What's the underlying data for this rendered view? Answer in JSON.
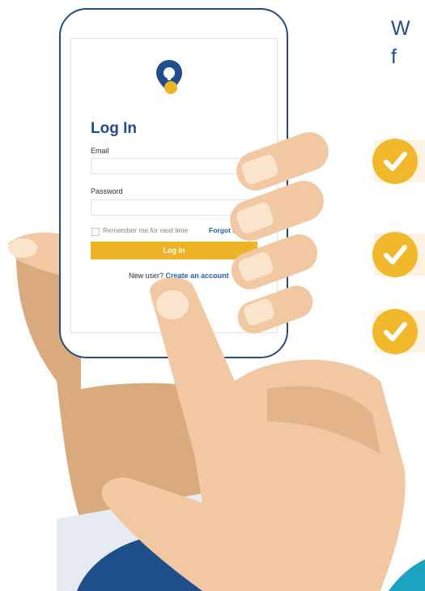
{
  "side_heading": "W\nf",
  "login_screen": {
    "title": "Log In",
    "email_label": "Email",
    "password_label": "Password",
    "remember_label": "Remember me for next time",
    "forgot_label": "Forgot Par",
    "login_button": "Log In",
    "new_user_text": "New user?",
    "create_account_link": "Create an account"
  },
  "checklist_icons": [
    "check-icon",
    "check-icon",
    "check-icon"
  ],
  "colors": {
    "brand_blue": "#1f4f8b",
    "accent_yellow": "#efb327",
    "skin": "#f2c8a2",
    "check_bg": "#fdf1e1"
  }
}
